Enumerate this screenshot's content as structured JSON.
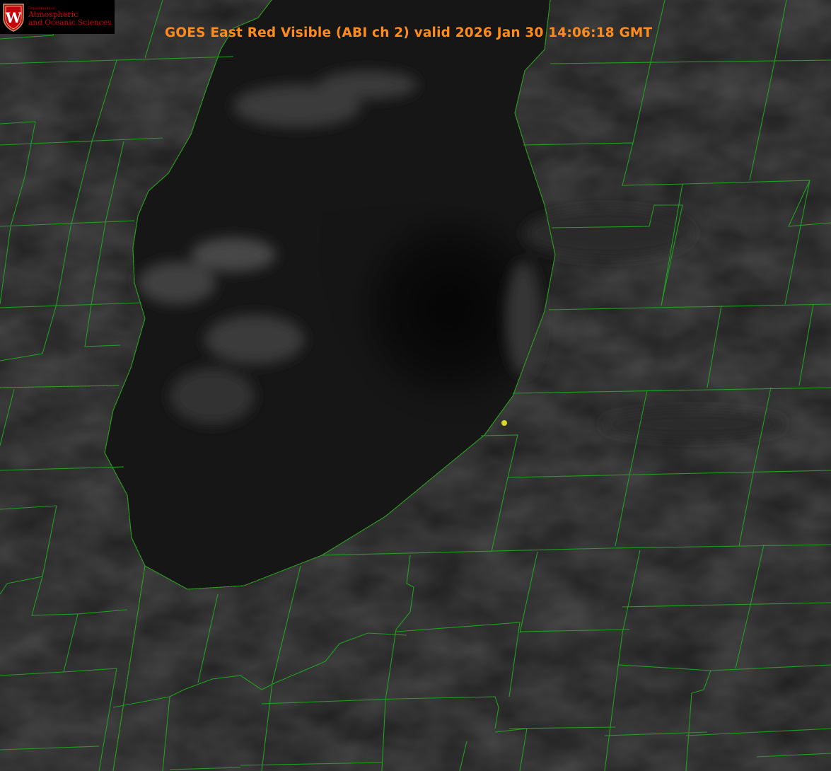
{
  "title": "GOES East Red Visible (ABI ch 2) valid 2026 Jan 30 14:06:18 GMT",
  "logo": {
    "department": "Department of",
    "line1": "Atmospheric",
    "line2": "and Oceanic Sciences",
    "crest_letter": "W",
    "crest_color": "#c5050c"
  },
  "colors": {
    "county_lines": "#1fa01f",
    "state_lines": "#c83c1e",
    "title": "#ff8c1a",
    "marker": "#d8d820"
  },
  "icons": {
    "crest": "uw-crest-icon",
    "marker": "location-dot-icon"
  }
}
